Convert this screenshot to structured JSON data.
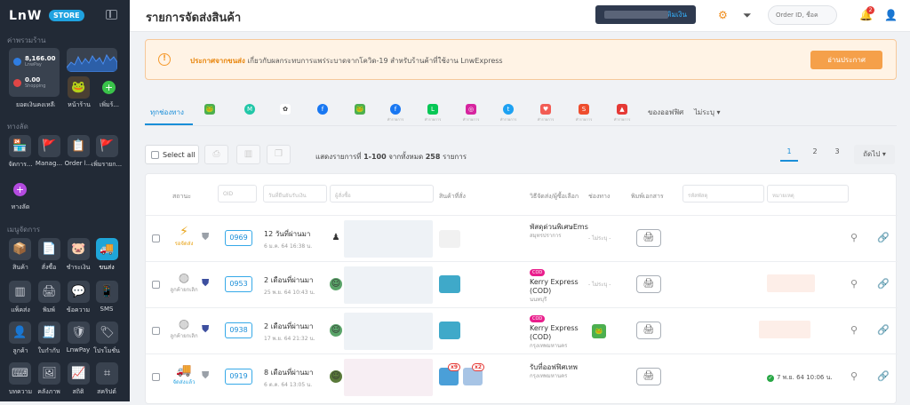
{
  "sidebar": {
    "logo": "LnW",
    "logo_badge": "STORE",
    "section_account": "ค่าพรวมร้าน",
    "balance": {
      "value1": "8,166.00",
      "label1": "LnwPay",
      "value2": "0.00",
      "label2": "Shopping"
    },
    "balance_caption": "ยอดเงินคงเหลือ",
    "shop_label": "หน้าร้าน",
    "add_label": "เพิ่มร้...",
    "section_shop": "ทางลัด",
    "shortcuts": [
      "จัดการ...",
      "Manag...",
      "Order l...",
      "เพิ่มรายก..."
    ],
    "shortcut_add": "ทางลัด",
    "section_manage": "เมนูจัดการ",
    "menu": [
      [
        "สินค้า",
        "สั่งซื้อ",
        "ชำระเงิน",
        "ขนส่ง"
      ],
      [
        "แพ็คส่ง",
        "พิมพ์",
        "ข้อความ",
        "SMS"
      ],
      [
        "ลูกค้า",
        "ใบกำกับ",
        "LnwPay",
        "โปรโมชั่น"
      ],
      [
        "บทความ",
        "คลังภาพ",
        "สถิติ",
        "สคริปต์"
      ]
    ]
  },
  "header": {
    "title": "รายการจัดส่งสินค้า",
    "promo_text": "แจ้งเติมเงิน",
    "search_placeholder": "Order ID, ชื่อค",
    "notif_count": "2"
  },
  "notice": {
    "highlight": "ประกาศจากขนส่ง",
    "text": " เกี่ยวกับผลกระทบการแพร่ระบาดจากโควิด-19 สำหรับร้านค้าที่ใช้งาน LnwExpress",
    "button": "อ่านประกาศ"
  },
  "channels": {
    "all": "ทุกช่องทาง",
    "sub": "ทำรายการ",
    "offline": "ของออฟฟิศ",
    "unspecified": "ไม่ระบุ ▾"
  },
  "toolbar": {
    "select_all": "Select all",
    "showing_prefix": "แสดงรายการที่ ",
    "showing_range": "1-100",
    "showing_mid": " จากทั้งหมด ",
    "showing_total": "258",
    "showing_suffix": " รายการ",
    "pages": [
      "1",
      "2",
      "3"
    ],
    "next": "ถัดไป ▾"
  },
  "table": {
    "col_status": "สถานะ",
    "col_oid": "OID",
    "col_date": "วันที่ยืนยันรับเงิน",
    "col_buyer": "ผู้สั่งซื้อ",
    "col_product": "สินค้าที่สั่ง",
    "col_shipping": "วิธีจัดส่ง/ผู้ซื้อเลือก",
    "col_channel": "ช่องทาง",
    "col_print": "พิมพ์เอกสาร",
    "col_tracking": "รหัสพัสดุ",
    "col_note": "หมายเหตุ",
    "rows": [
      {
        "status": "รอจัดส่ง",
        "id": "0969",
        "time": "12 วันที่ผ่านมา",
        "date": "6 ม.ค. 64 16:38 น.",
        "ship": "พัสดุด่วนพิเศษEms",
        "ship2": "",
        "area": "สมุทรปราการ",
        "cod": "",
        "chan": "- ไม่ระบุ -"
      },
      {
        "status": "ลูกค้ายกเลิก",
        "id": "0953",
        "time": "2 เดือนที่ผ่านมา",
        "date": "25 พ.ย. 64 10:43 น.",
        "ship": "Kerry Express",
        "ship2": "(COD)",
        "area": "นนทบุรี",
        "cod": "COD",
        "chan": "- ไม่ระบุ -"
      },
      {
        "status": "ลูกค้ายกเลิก",
        "id": "0938",
        "time": "2 เดือนที่ผ่านมา",
        "date": "17 พ.ย. 64 21:32 น.",
        "ship": "Kerry Express",
        "ship2": "(COD)",
        "area": "กรุงเทพมหานคร",
        "cod": "COD",
        "chan": ""
      },
      {
        "status": "จัดส่งแล้ว",
        "id": "0919",
        "time": "8 เดือนที่ผ่านมา",
        "date": "6 ต.ค. 64 13:05 น.",
        "ship": "รับที่ออฟฟิศเทพ",
        "ship2": "",
        "area": "กรุงเทพมหานคร",
        "cod": "",
        "chan": "",
        "delivered": "7 พ.ย. 64 10:06 น.",
        "qty1": "x9",
        "qty2": "x2"
      }
    ]
  }
}
